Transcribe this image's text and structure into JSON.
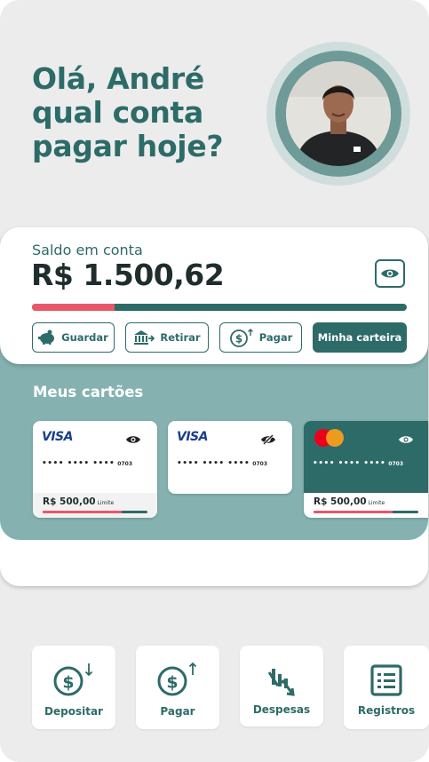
{
  "greeting": {
    "line1": "Olá, André",
    "line2": "qual conta",
    "line3": "pagar hoje?"
  },
  "balance": {
    "label": "Saldo em conta",
    "value": "R$ 1.500,62",
    "spent_fraction": 0.22
  },
  "actions": [
    {
      "label": "Guardar",
      "icon": "piggy-bank-icon"
    },
    {
      "label": "Retirar",
      "icon": "bank-withdraw-icon"
    },
    {
      "label": "Pagar",
      "icon": "dollar-up-icon"
    },
    {
      "label": "Minha carteira",
      "icon": ""
    }
  ],
  "cards_section": {
    "title": "Meus cartões",
    "cards": [
      {
        "brand": "VISA",
        "number_masked": "•••• •••• ••••",
        "last_digits": "0703",
        "limit": "R$ 500,00",
        "limit_label": "Limite",
        "used_fraction": 0.75,
        "visibility_icon": "eye-icon"
      },
      {
        "brand": "VISA",
        "number_masked": "•••• •••• ••••",
        "last_digits": "0703",
        "visibility_icon": "eye-off-icon"
      },
      {
        "brand": "Mastercard",
        "number_masked": "•••• •••• ••••",
        "last_digits": "0703",
        "limit": "R$ 500,00",
        "limit_label": "Limite",
        "used_fraction": 0.75,
        "visibility_icon": "eye-icon"
      }
    ]
  },
  "quick_actions": [
    {
      "label": "Depositar",
      "icon": "dollar-down-icon"
    },
    {
      "label": "Pagar",
      "icon": "dollar-up-icon"
    },
    {
      "label": "Despesas",
      "icon": "chart-down-icon"
    },
    {
      "label": "Registros",
      "icon": "list-icon"
    }
  ],
  "colors": {
    "primary": "#2d6b68",
    "accent": "#e9576b",
    "panel": "#85b2b0",
    "background": "#ececec",
    "visa_blue": "#1a3d8f",
    "mastercard_red": "#eb001b",
    "mastercard_orange": "#f79e1b"
  }
}
